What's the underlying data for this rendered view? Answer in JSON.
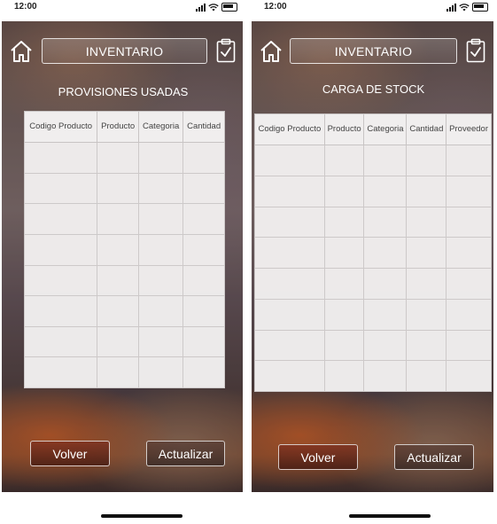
{
  "screens": [
    {
      "time": "12:00",
      "header_title": "INVENTARIO",
      "subtitle": "PROVISIONES USADAS",
      "columns": [
        "Codigo Producto",
        "Producto",
        "Categoria",
        "Cantidad"
      ],
      "row_count": 8,
      "buttons": {
        "back": "Volver",
        "update": "Actualizar"
      }
    },
    {
      "time": "12:00",
      "header_title": "INVENTARIO",
      "subtitle": "CARGA DE STOCK",
      "columns": [
        "Codigo Producto",
        "Producto",
        "Categoria",
        "Cantidad",
        "Proveedor"
      ],
      "row_count": 8,
      "buttons": {
        "back": "Volver",
        "update": "Actualizar"
      }
    }
  ]
}
